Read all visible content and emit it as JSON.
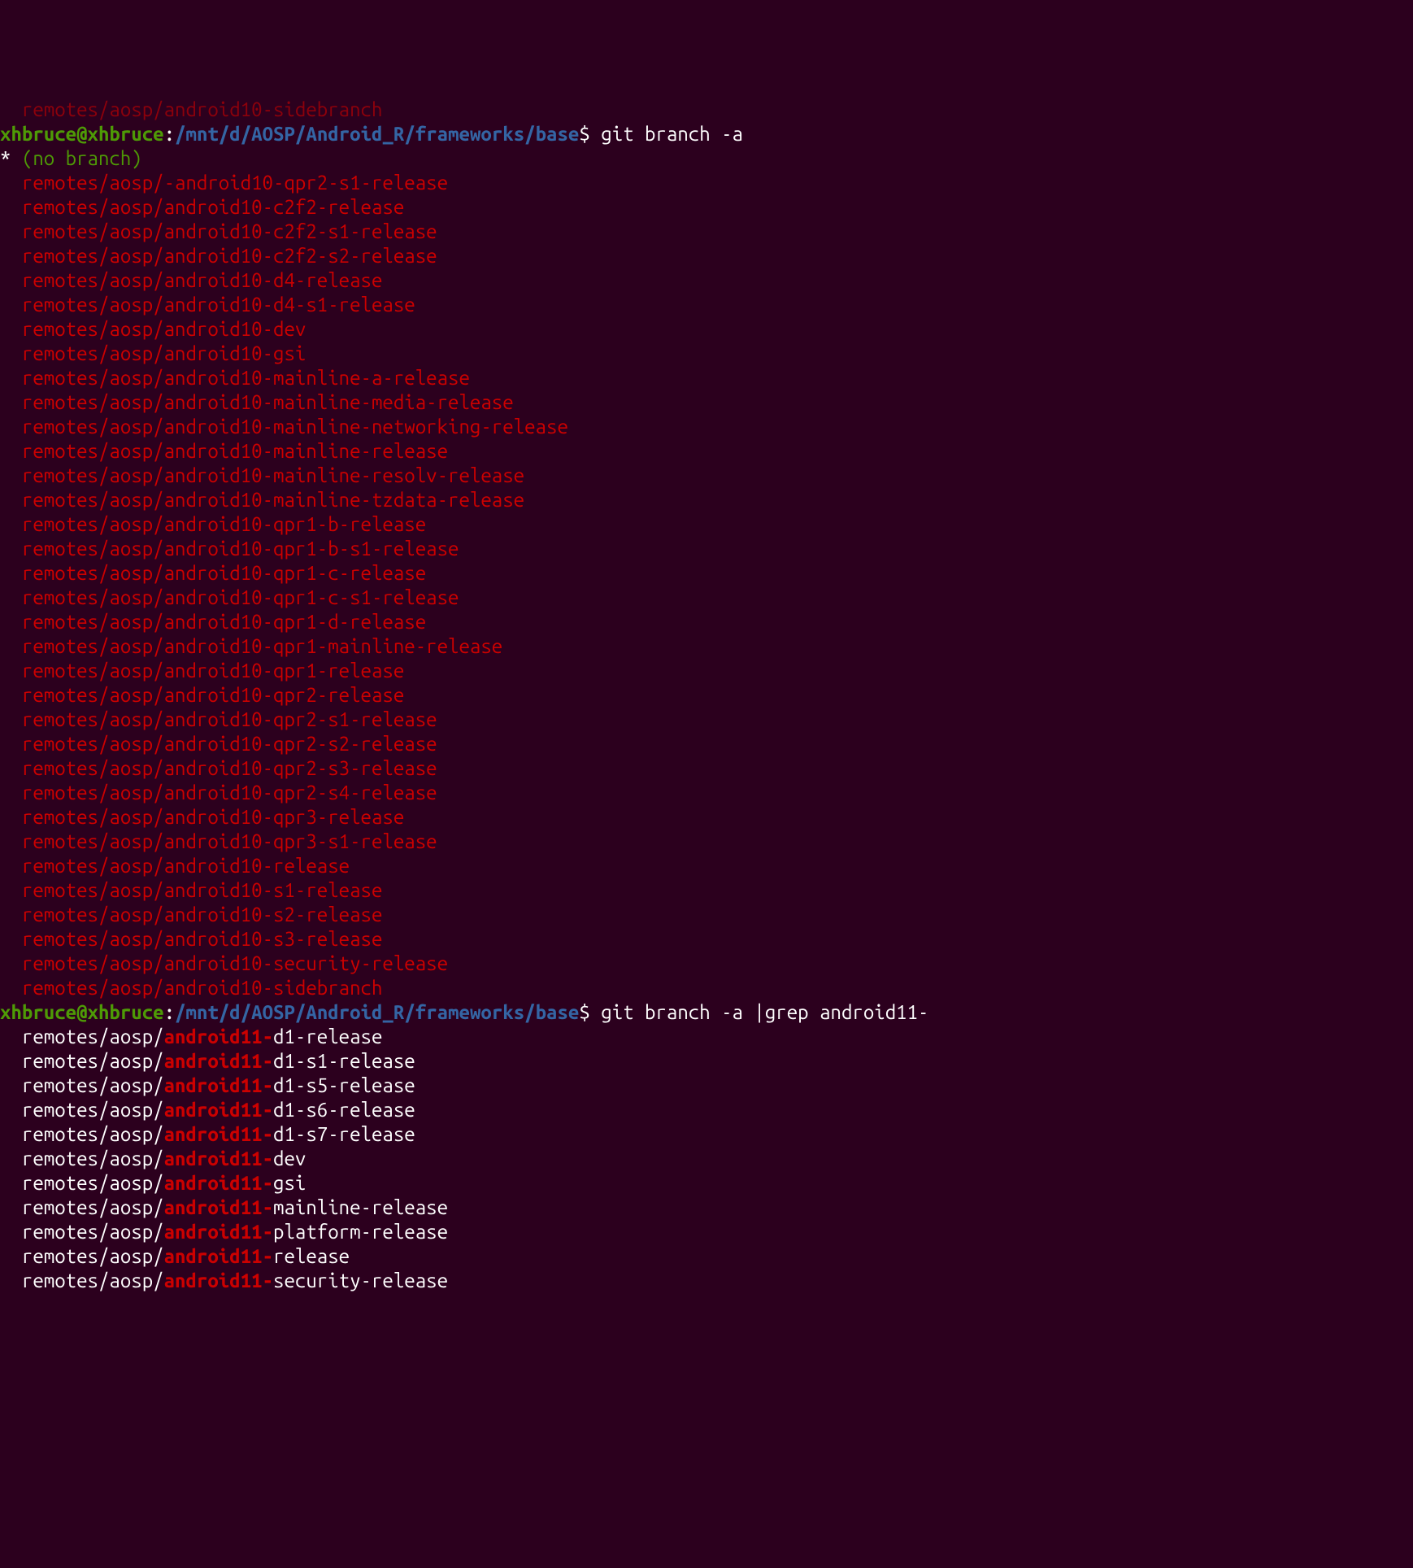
{
  "cutoff_line": "  remotes/aosp/android10-sidebranch",
  "prompt1": {
    "user": "xhbruce",
    "at": "@",
    "host": "xhbruce",
    "colon": ":",
    "path": "/mnt/d/AOSP/Android_R/frameworks/base",
    "dollar": "$ ",
    "command": "git branch -a"
  },
  "star": "*",
  "no_branch": " (no branch)",
  "remote_branches": [
    "  remotes/aosp/-android10-qpr2-s1-release",
    "  remotes/aosp/android10-c2f2-release",
    "  remotes/aosp/android10-c2f2-s1-release",
    "  remotes/aosp/android10-c2f2-s2-release",
    "  remotes/aosp/android10-d4-release",
    "  remotes/aosp/android10-d4-s1-release",
    "  remotes/aosp/android10-dev",
    "  remotes/aosp/android10-gsi",
    "  remotes/aosp/android10-mainline-a-release",
    "  remotes/aosp/android10-mainline-media-release",
    "  remotes/aosp/android10-mainline-networking-release",
    "  remotes/aosp/android10-mainline-release",
    "  remotes/aosp/android10-mainline-resolv-release",
    "  remotes/aosp/android10-mainline-tzdata-release",
    "  remotes/aosp/android10-qpr1-b-release",
    "  remotes/aosp/android10-qpr1-b-s1-release",
    "  remotes/aosp/android10-qpr1-c-release",
    "  remotes/aosp/android10-qpr1-c-s1-release",
    "  remotes/aosp/android10-qpr1-d-release",
    "  remotes/aosp/android10-qpr1-mainline-release",
    "  remotes/aosp/android10-qpr1-release",
    "  remotes/aosp/android10-qpr2-release",
    "  remotes/aosp/android10-qpr2-s1-release",
    "  remotes/aosp/android10-qpr2-s2-release",
    "  remotes/aosp/android10-qpr2-s3-release",
    "  remotes/aosp/android10-qpr2-s4-release",
    "  remotes/aosp/android10-qpr3-release",
    "  remotes/aosp/android10-qpr3-s1-release",
    "  remotes/aosp/android10-release",
    "  remotes/aosp/android10-s1-release",
    "  remotes/aosp/android10-s2-release",
    "  remotes/aosp/android10-s3-release",
    "  remotes/aosp/android10-security-release",
    "  remotes/aosp/android10-sidebranch"
  ],
  "prompt2": {
    "user": "xhbruce",
    "at": "@",
    "host": "xhbruce",
    "colon": ":",
    "path": "/mnt/d/AOSP/Android_R/frameworks/base",
    "dollar": "$ ",
    "command": "git branch -a |grep android11-"
  },
  "grep_results": [
    {
      "pre": "  remotes/aosp/",
      "match": "android11-",
      "post": "d1-release"
    },
    {
      "pre": "  remotes/aosp/",
      "match": "android11-",
      "post": "d1-s1-release"
    },
    {
      "pre": "  remotes/aosp/",
      "match": "android11-",
      "post": "d1-s5-release"
    },
    {
      "pre": "  remotes/aosp/",
      "match": "android11-",
      "post": "d1-s6-release"
    },
    {
      "pre": "  remotes/aosp/",
      "match": "android11-",
      "post": "d1-s7-release"
    },
    {
      "pre": "  remotes/aosp/",
      "match": "android11-",
      "post": "dev"
    },
    {
      "pre": "  remotes/aosp/",
      "match": "android11-",
      "post": "gsi"
    },
    {
      "pre": "  remotes/aosp/",
      "match": "android11-",
      "post": "mainline-release"
    },
    {
      "pre": "  remotes/aosp/",
      "match": "android11-",
      "post": "platform-release"
    },
    {
      "pre": "  remotes/aosp/",
      "match": "android11-",
      "post": "release"
    },
    {
      "pre": "  remotes/aosp/",
      "match": "android11-",
      "post": "security-release"
    }
  ]
}
